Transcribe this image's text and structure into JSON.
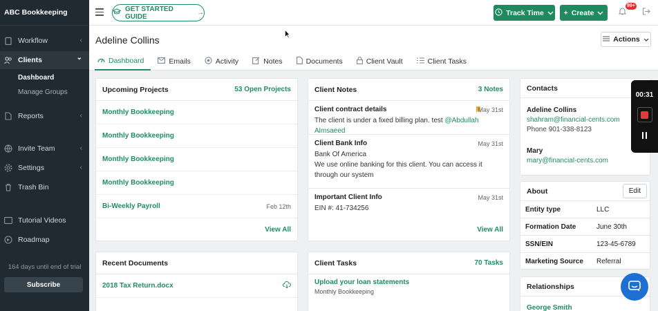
{
  "app": {
    "brand": "ABC Bookkeeping"
  },
  "sidebar": {
    "items": [
      {
        "label": "Workflow",
        "icon": "clipboard-icon",
        "chevron": "‹"
      },
      {
        "label": "Clients",
        "icon": "users-icon",
        "chevron": "⌄"
      },
      {
        "label": "Reports",
        "icon": "document-icon",
        "chevron": "‹"
      },
      {
        "label": "Invite Team",
        "icon": "globe-icon",
        "chevron": "‹"
      },
      {
        "label": "Settings",
        "icon": "gear-icon",
        "chevron": "‹"
      },
      {
        "label": "Trash Bin",
        "icon": "trash-icon",
        "chevron": ""
      },
      {
        "label": "Tutorial Videos",
        "icon": "video-icon",
        "chevron": ""
      },
      {
        "label": "Roadmap",
        "icon": "map-icon",
        "chevron": ""
      }
    ],
    "sub_items": [
      "Dashboard",
      "Manage Groups"
    ],
    "trial_text": "164 days until end of trial",
    "subscribe_label": "Subscribe"
  },
  "topbar": {
    "guide_label": "GET STARTED GUIDE",
    "track_time_label": "Track Time",
    "create_label": "Create",
    "notification_badge": "99+"
  },
  "header": {
    "client_name": "Adeline Collins",
    "actions_label": "Actions",
    "tabs": [
      "Dashboard",
      "Emails",
      "Activity",
      "Notes",
      "Documents",
      "Client Vault",
      "Client Tasks"
    ]
  },
  "upcoming_projects": {
    "title": "Upcoming Projects",
    "count_label": "53 Open Projects",
    "rows": [
      {
        "name": "Monthly Bookkeeping",
        "date": ""
      },
      {
        "name": "Monthly Bookkeeping",
        "date": ""
      },
      {
        "name": "Monthly Bookkeeping",
        "date": ""
      },
      {
        "name": "Monthly Bookkeeping",
        "date": ""
      },
      {
        "name": "Bi-Weekly Payroll",
        "date": "Feb 12th"
      }
    ],
    "view_all": "View All"
  },
  "client_notes": {
    "title": "Client Notes",
    "count_label": "3 Notes",
    "notes": [
      {
        "title": "Client contract details",
        "date": "May 31st",
        "body": "The client is under a fixed billing plan. test ",
        "mention": "@Abdullah Almsaeed"
      },
      {
        "title": "Client Bank Info",
        "date": "May 31st",
        "body": "Bank Of America",
        "body2": "We use online banking for this client. You can access it through our system"
      },
      {
        "title": "Important Client Info",
        "date": "May 31st",
        "body": "EIN #: 41-734256"
      }
    ],
    "view_all": "View All"
  },
  "recent_documents": {
    "title": "Recent Documents",
    "rows": [
      "2018 Tax Return.docx"
    ]
  },
  "client_tasks": {
    "title": "Client Tasks",
    "count_label": "70 Tasks",
    "rows": [
      {
        "name": "Upload your loan statements",
        "project": "Monthly Bookkeeping"
      }
    ]
  },
  "contacts": {
    "title": "Contacts",
    "list": [
      {
        "name": "Adeline Collins",
        "email": "shahram@financial-cents.com",
        "phone": "Phone 901-338-8123"
      },
      {
        "name": "Mary",
        "email": "mary@financial-cents.com"
      }
    ]
  },
  "about": {
    "title": "About",
    "edit_label": "Edit",
    "rows": [
      {
        "key": "Entity type",
        "value": "LLC"
      },
      {
        "key": "Formation Date",
        "value": "June 30th"
      },
      {
        "key": "SSN/EIN",
        "value": "123-45-6789"
      },
      {
        "key": "Marketing Source",
        "value": "Referral"
      }
    ]
  },
  "relationships": {
    "title": "Relationships",
    "first": "George Smith"
  },
  "recorder": {
    "time": "00:31"
  },
  "colors": {
    "accent": "#1e8d64",
    "sidebar": "#1f2a33",
    "badge": "#d9322c"
  }
}
